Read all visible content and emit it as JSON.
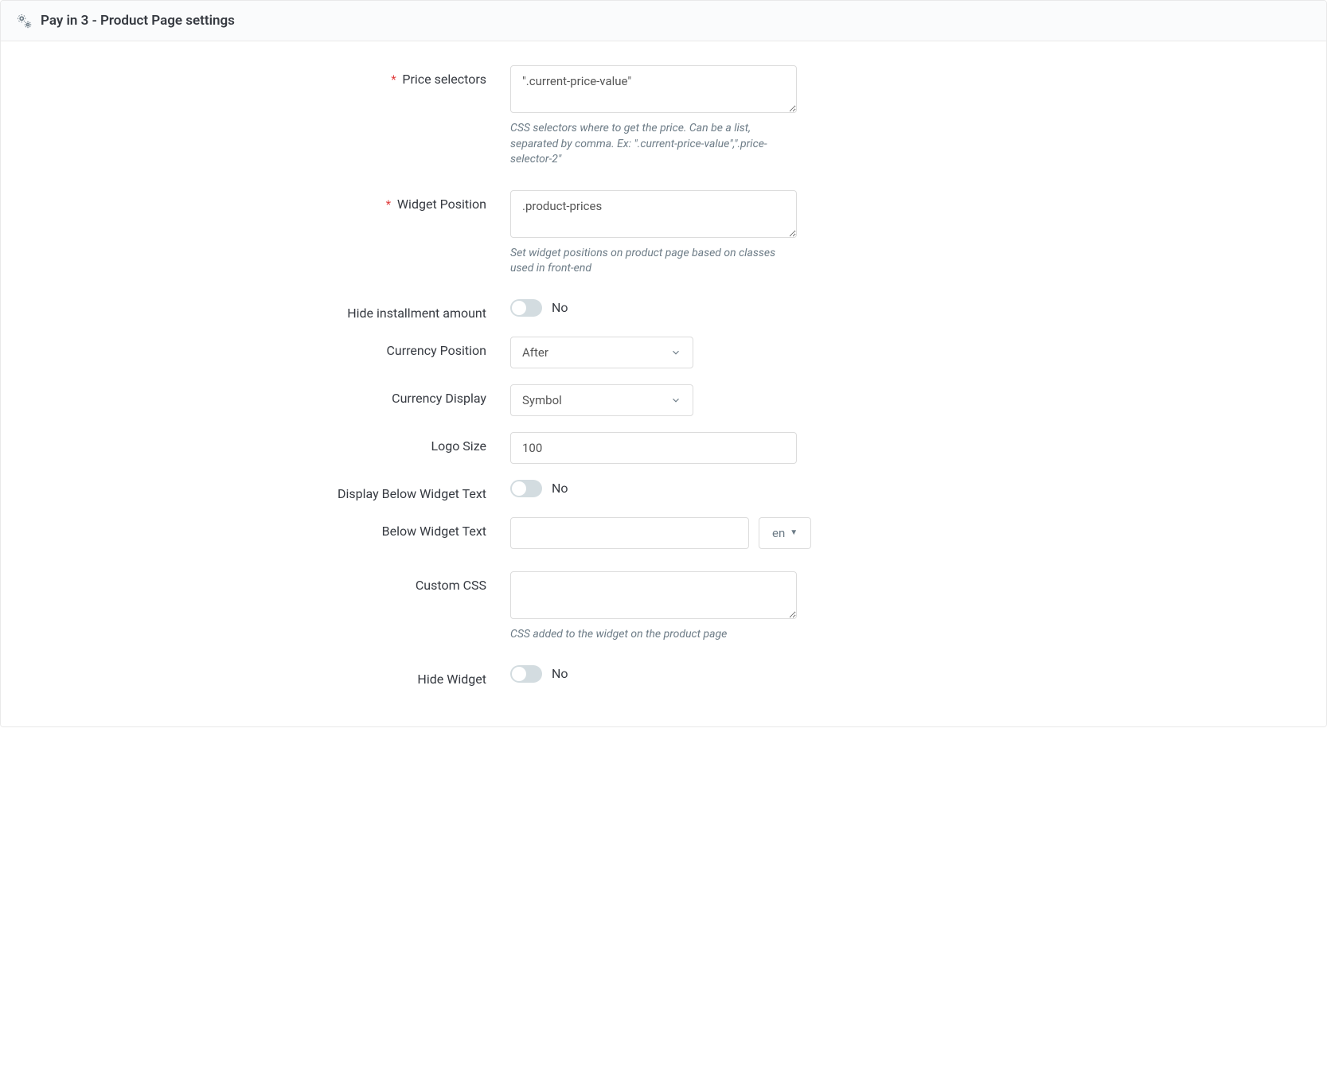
{
  "panel": {
    "title": "Pay in 3 - Product Page settings"
  },
  "fields": {
    "priceSelectors": {
      "label": "Price selectors",
      "required": true,
      "value": "\".current-price-value\"",
      "help": "CSS selectors where to get the price. Can be a list, separated by comma. Ex: \".current-price-value\",\".price-selector-2\""
    },
    "widgetPosition": {
      "label": "Widget Position",
      "required": true,
      "value": ".product-prices",
      "help": "Set widget positions on product page based on classes used in front-end"
    },
    "hideInstallment": {
      "label": "Hide installment amount",
      "on": false,
      "text": "No"
    },
    "currencyPosition": {
      "label": "Currency Position",
      "value": "After"
    },
    "currencyDisplay": {
      "label": "Currency Display",
      "value": "Symbol"
    },
    "logoSize": {
      "label": "Logo Size",
      "value": "100"
    },
    "displayBelowWidgetText": {
      "label": "Display Below Widget Text",
      "on": false,
      "text": "No"
    },
    "belowWidgetText": {
      "label": "Below Widget Text",
      "value": "",
      "lang": "en"
    },
    "customCss": {
      "label": "Custom CSS",
      "value": "",
      "help": "CSS added to the widget on the product page"
    },
    "hideWidget": {
      "label": "Hide Widget",
      "on": false,
      "text": "No"
    }
  }
}
